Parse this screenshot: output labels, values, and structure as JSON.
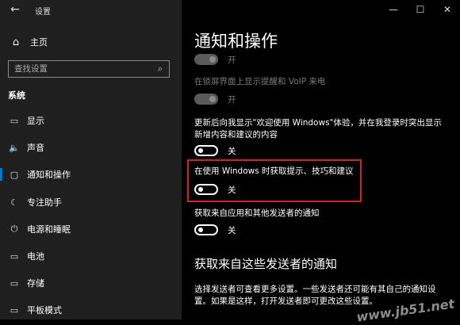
{
  "window": {
    "title": "设置",
    "back_icon": "←",
    "minimize_icon": "—",
    "maximize_icon": "☐",
    "close_icon": "✕"
  },
  "sidebar": {
    "home_icon": "⌂",
    "home_label": "主页",
    "search_placeholder": "查找设置",
    "search_icon": "⌕",
    "section_title": "系统",
    "items": [
      {
        "icon": "▭",
        "label": "显示",
        "active": false
      },
      {
        "icon": "🔈",
        "label": "声音",
        "active": false
      },
      {
        "icon": "▢",
        "label": "通知和操作",
        "active": true
      },
      {
        "icon": "☾",
        "label": "专注助手",
        "active": false
      },
      {
        "icon": "⏻",
        "label": "电源和睡眠",
        "active": false
      },
      {
        "icon": "▭",
        "label": "电池",
        "active": false
      },
      {
        "icon": "▭",
        "label": "存储",
        "active": false
      },
      {
        "icon": "▭",
        "label": "平板模式",
        "active": false
      }
    ]
  },
  "main": {
    "page_title": "通知和操作",
    "toggle1_label": "开",
    "lock_screen_text": "在锁屏界面上显示提醒和 VoIP 来电",
    "toggle2_label": "开",
    "welcome_text_line1": "更新后向我显示\"欢迎使用 Windows\"体验，并在我登录时突出显示",
    "welcome_text_line2": "新增内容和建议的内容",
    "toggle3_label": "关",
    "tips_text": "在使用 Windows 时获取提示、技巧和建议",
    "toggle4_label": "关",
    "app_notify_text": "获取来自应用和其他发送者的通知",
    "toggle5_label": "关",
    "senders_heading": "获取来自这些发送者的通知",
    "senders_desc_line1": "选择发送者可查看更多设置。一些发送者还可能有其自己的通知设",
    "senders_desc_line2": "置。如果是这样，打开发送者即可更改这些设置。"
  },
  "watermark": "www.jb51.net"
}
